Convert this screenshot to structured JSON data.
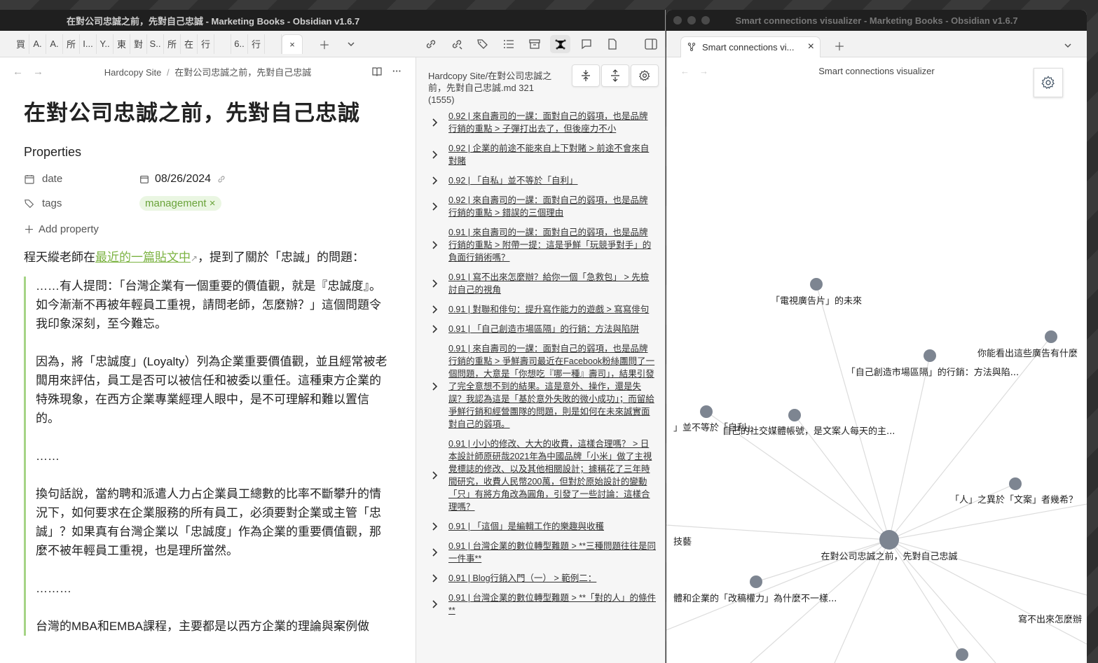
{
  "left_window": {
    "title": "在對公司忠誠之前，先對自己忠誠 - Marketing Books - Obsidian v1.6.7",
    "tabs": [
      "買",
      "A.",
      "A.",
      "所",
      "I...",
      "Y..",
      "東",
      "對",
      "S..",
      "所",
      "在",
      "行",
      "",
      "6..",
      "行",
      ""
    ],
    "breadcrumb": {
      "folder": "Hardcopy Site",
      "separator": "/",
      "note": "在對公司忠誠之前，先對自己忠誠"
    },
    "note": {
      "title": "在對公司忠誠之前，先對自己忠誠",
      "properties_heading": "Properties",
      "date_key": "date",
      "date_value": "08/26/2024",
      "tags_key": "tags",
      "tag_value": "management",
      "add_property_label": "Add property",
      "intro_before": "程天縱老師在",
      "intro_link": "最近的一篇貼文中",
      "intro_after": "，提到了關於「忠誠」的問題：",
      "quote": [
        "……有人提問：「台灣企業有一個重要的價值觀，就是『忠誠度』。如今漸漸不再被年輕員工重視，請問老師，怎麼辦？」這個問題令我印象深刻，至今難忘。",
        "因為，將「忠誠度」(Loyalty）列為企業重要價值觀，並且經常被老闆用來評估，員工是否可以被信任和被委以重任。這種東方企業的特殊現象，在西方企業專業經理人眼中，是不可理解和難以置信的。",
        "……",
        "換句話說，當約聘和派遣人力占企業員工總數的比率不斷攀升的情況下，如何要求在企業服務的所有員工，必須要對企業或主管「忠誠」？如果真有台灣企業以「忠誠度」作為企業的重要價值觀，那麼不被年輕員工重視，也是理所當然。",
        "………",
        "台灣的MBA和EMBA課程，主要都是以西方企業的理論與案例做"
      ]
    },
    "connections_pane": {
      "path": "Hardcopy Site/在對公司忠誠之前，先對自己忠誠.md 321 (1555)",
      "results": [
        "0.92 | 來自壽司的一課：面對自己的弱項，也是品牌行銷的重點 > 子彈打出去了，但後座力不小",
        "0.92 | 企業的前途不能來自上下對賭 > 前途不會來自對賭",
        "0.92 | 「自私」並不等於「自利」",
        "0.92 | 來自壽司的一課：面對自己的弱項，也是品牌行銷的重點 > 錯誤的三個理由",
        "0.91 | 來自壽司的一課：面對自己的弱項，也是品牌行銷的重點 > 附帶一提：這是爭鮮「玩競爭對手」的負面行銷術嗎？",
        "0.91 | 寫不出來怎麼辦？給你一個「急救包」 > 先檢討自己的視角",
        "0.91 | 對聯和俳句：提升寫作能力的遊戲 > 寫寫俳句",
        "0.91 | 「自己創造市場區隔」的行銷：方法與陷阱",
        "0.91 | 來自壽司的一課：面對自己的弱項，也是品牌行銷的重點 > 爭鮮壽司最近在Facebook粉絲團問了一個問題，大意是「你想吃『哪一種』壽司」，結果引發了完全意想不到的結果。這是意外、操作，還是失誤？我認為這是「基於意外失敗的微小成功」；而留給爭鮮行銷和經營團隊的問題，則是如何在未來誠實面對自己的弱項。",
        "0.91 | 小小的修改、大大的收費，這樣合理嗎？ > 日本設計師原研哉2021年為中國品牌「小米」做了主視覺標誌的修改、以及其他相關設計；據稱花了三年時間研究，收費人民幣200萬，但對於原始設計的變動「只」有將方角改為圓角，引發了一些討論：這樣合理嗎？",
        "0.91 | 「這個」是編輯工作的樂趣與收穫",
        "0.91 | 台灣企業的數位轉型難題 > **三種問題往往是同一件事**",
        "0.91 | Blog行銷入門（一） > 範例二：",
        "0.91 | 台灣企業的數位轉型難題 > **「對的人」的條件**"
      ]
    }
  },
  "right_window": {
    "title": "Smart connections visualizer - Marketing Books - Obsidian v1.6.7",
    "tab_label": "Smart connections vi...",
    "header": "Smart connections visualizer",
    "graph_labels": [
      "「電視廣告片」的未來",
      "你能看出這些廣告有什麼",
      "「自己創造市場區隔」的行銷：方法與陷...",
      "」並不等於「自利」",
      "自己的社交媒體帳號，是文案人每天的主...",
      "「人」之異於「文案」者幾希？",
      "技藝",
      "在對公司忠誠之前，先對自己忠誠",
      "體和企業的「改稿權力」為什麼不一樣...",
      "寫不出來怎麼辦"
    ]
  }
}
